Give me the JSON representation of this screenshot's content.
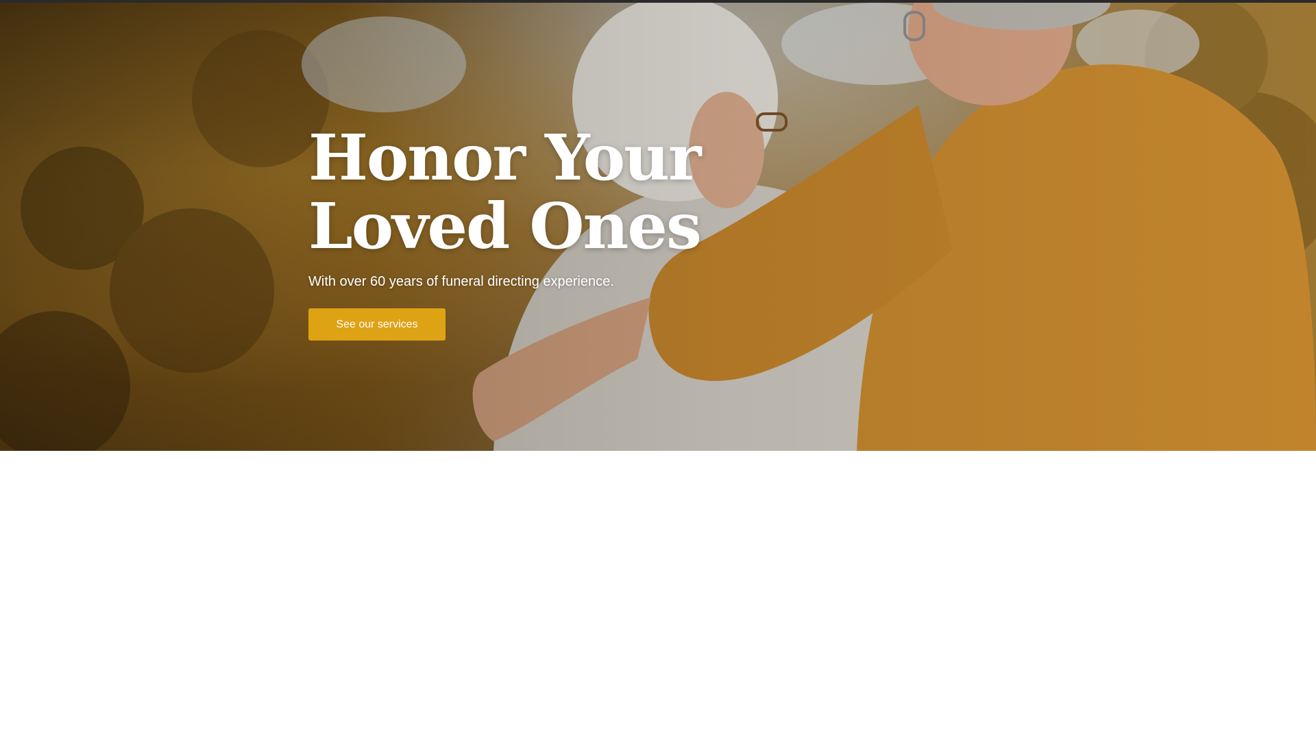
{
  "hero": {
    "title": "Honor Your\nLoved Ones",
    "subtitle": "With over 60 years of funeral directing experience.",
    "cta_label": "See our services",
    "background_image": "elderly-couple-embracing-autumn-photo",
    "colors": {
      "accent": "#dea215",
      "text": "#ffffff",
      "sweater": "#c8892f"
    }
  }
}
